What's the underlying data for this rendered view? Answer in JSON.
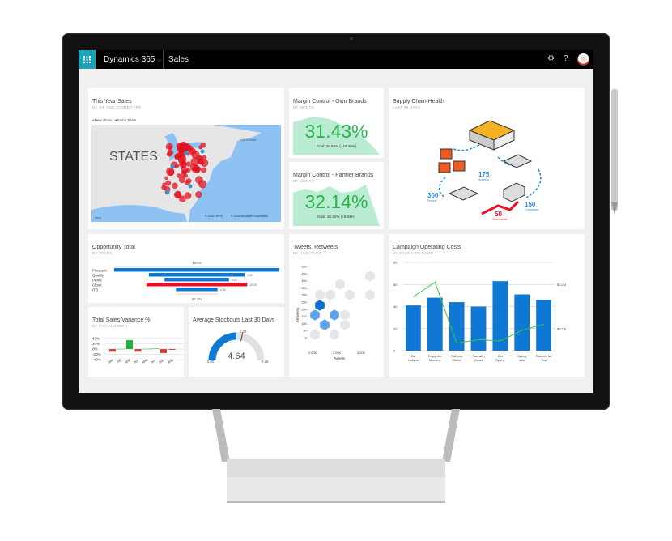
{
  "topbar": {
    "app": "Dynamics 365",
    "area": "Sales",
    "icons": [
      "waffle-icon",
      "chevron-down-icon",
      "gear-icon",
      "help-icon",
      "avatar"
    ]
  },
  "tiles": {
    "sales_map": {
      "title": "This Year Sales",
      "subtitle": "BY ZIP AND STORE TYPE",
      "legend": [
        {
          "label": "New Store",
          "color": "#1e9fd8"
        },
        {
          "label": "Same Store",
          "color": "#e81123"
        }
      ],
      "map_label": "STATES",
      "gulf_label": "Gulf of Maine",
      "copyright_here": "© 2016 HERE",
      "copyright_ms": "© 2016 Microsoft Corporation",
      "bing": "bing"
    },
    "margin_own": {
      "title": "Margin Control - Own Brands",
      "subtitle": "BY MONTH",
      "value": "31.43%",
      "goal": "Goal: 26.55% (+18.36%)"
    },
    "margin_partner": {
      "title": "Margin Control - Partner Brands",
      "subtitle": "BY MONTH",
      "value": "32.14%",
      "goal": "Goal: 30.34% (+5.93%)"
    },
    "supply": {
      "title": "Supply Chain Health",
      "subtitle": "LAST 29 DAYS",
      "nodes": [
        {
          "value": "175",
          "label": "Supplier"
        },
        {
          "value": "300",
          "label": "Factory"
        },
        {
          "value": "150",
          "label": "Customers"
        },
        {
          "value": "50",
          "label": "Distribution"
        }
      ]
    },
    "opportunity": {
      "title": "Opportunity Total",
      "subtitle": "BY STAGE",
      "top_label": "100%",
      "bottom_label": "25.2%",
      "stages": [
        {
          "name": "Prospect",
          "label": "",
          "share": 100,
          "color": "#0f78d4"
        },
        {
          "name": "Qualify",
          "label": "9.6K",
          "share": 58,
          "color": "#0f78d4"
        },
        {
          "name": "Prove",
          "label": "6.4K",
          "share": 39,
          "color": "#0f78d4"
        },
        {
          "name": "Close",
          "label": "10.2K",
          "share": 61,
          "color": "#e81123"
        },
        {
          "name": "ITB",
          "label": "4.2K",
          "share": 25.2,
          "color": "#0f78d4"
        }
      ]
    },
    "variance": {
      "title": "Total Sales Variance %",
      "subtitle": "BY FISCALMONTH",
      "yticks": [
        "40%",
        "20%",
        "0%",
        "-20%",
        "-40%"
      ],
      "months": [
        "Jan",
        "Feb",
        "Mar",
        "Apr",
        "May",
        "Jun",
        "Jul",
        "Aug"
      ],
      "values": [
        -10,
        0,
        33,
        -10,
        0,
        1,
        -15,
        -3
      ],
      "pos_color": "#1db33c",
      "neg_color": "#d9413a"
    },
    "stockouts": {
      "title": "Average Stockouts Last 30 Days",
      "value": "4.64",
      "min": "0.00",
      "max": "9.28",
      "target": "5.30",
      "value_num": 4.64,
      "min_num": 0,
      "max_num": 9.28,
      "target_num": 5.3,
      "color": "#0f78d4"
    },
    "tweets": {
      "title": "Tweets, Retweets",
      "subtitle": "BY HASHTAGS",
      "ylabel": "Retweets",
      "xlabel": "Tweets",
      "yticks": [
        "500",
        "450",
        "400",
        "350",
        "300",
        "250",
        "200",
        "150",
        "100",
        "50",
        "0"
      ],
      "xticks": [
        "0.00K",
        "2.00K",
        "4.00K"
      ]
    }
  },
  "chart_data": {
    "type": "bar",
    "title": "Campaign Operating Costs",
    "subtitle": "BY CAMPAIGN NAME",
    "categories": [
      "Be Unique",
      "Enjoy the Moment",
      "Fall into Winter",
      "Fun with Colors",
      "Get Sporty",
      "Spring into",
      "Tailored for You"
    ],
    "series": [
      {
        "type": "bar",
        "axis": "left",
        "values": [
          41,
          48,
          44,
          40,
          63,
          51,
          46
        ],
        "color": "#0f78d4"
      },
      {
        "type": "line",
        "axis": "right",
        "values": [
          0.172,
          0.205,
          0.067,
          0.075,
          0.072,
          0.096,
          0.11
        ],
        "color": "#35c848"
      }
    ],
    "ylim": [
      0,
      80
    ],
    "yticks": [
      "0",
      "20",
      "40",
      "60",
      "80"
    ],
    "y2ticks": [
      "$0.1M",
      "$0.2M"
    ],
    "y2_values": [
      0.1,
      0.2
    ],
    "grid": true
  }
}
